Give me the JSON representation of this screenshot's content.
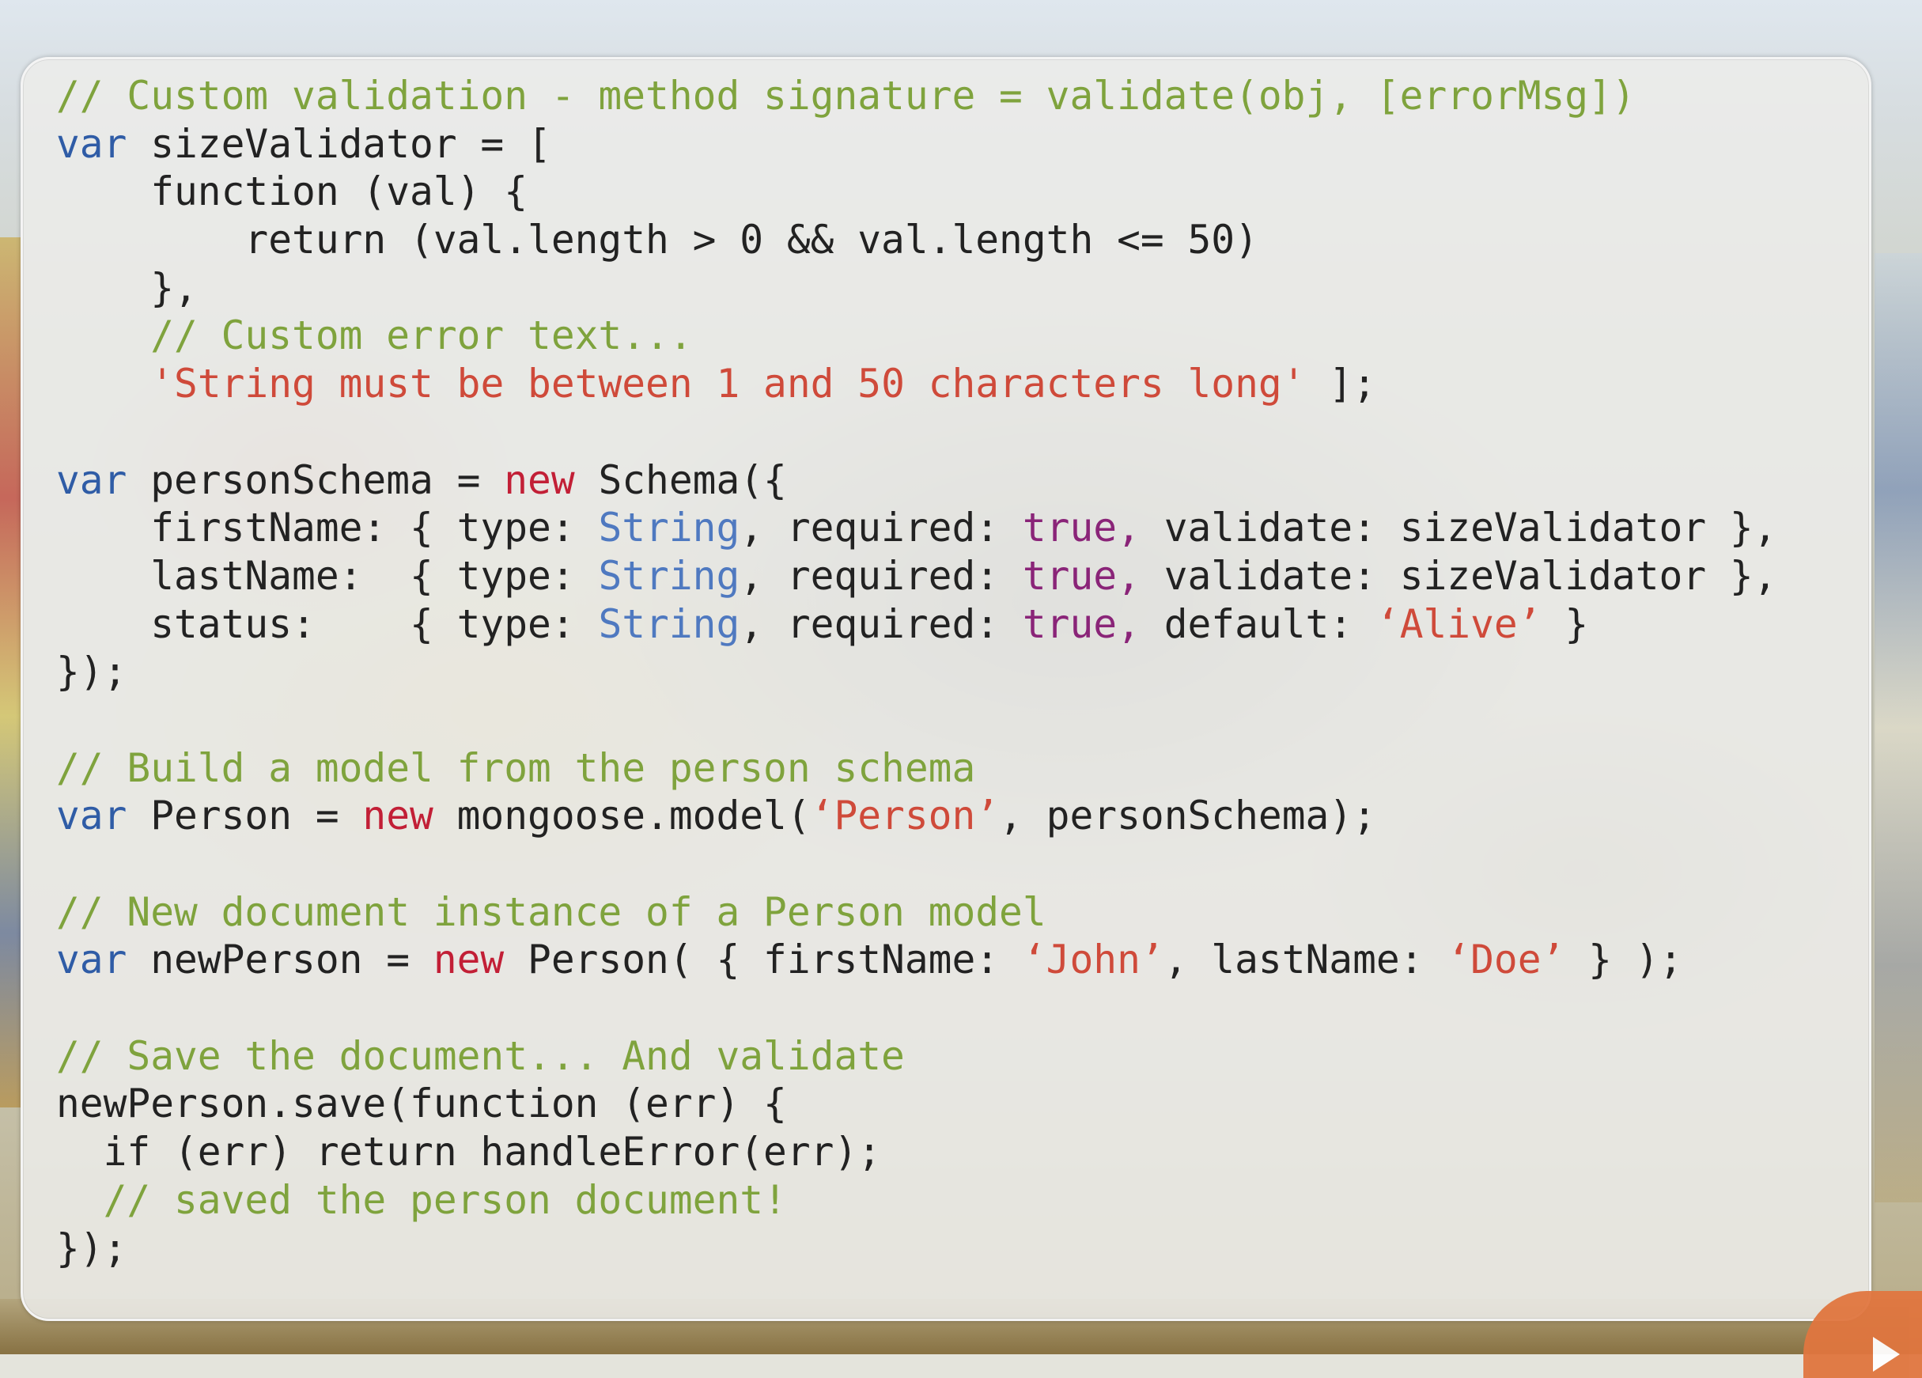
{
  "slide": {
    "background": "vintage-car-photo",
    "accent_color": "#e0763f"
  },
  "code_panel": {
    "colors": {
      "comment": "#7fa33d",
      "keyword": "#2f5ca6",
      "string": "#cf4a3a",
      "new": "#c21f36",
      "boolean": "#8a2478",
      "type": "#4f79c0",
      "plain": "#222222"
    },
    "lines": [
      [
        {
          "t": "// Custom validation - method signature = validate(obj, [errorMsg])",
          "c": "comment"
        }
      ],
      [
        {
          "t": "var",
          "c": "keyword"
        },
        {
          "t": " sizeValidator = [",
          "c": "plain"
        }
      ],
      [
        {
          "t": "    function (val) {",
          "c": "plain"
        }
      ],
      [
        {
          "t": "        return (val.length > 0 && val.length <= 50)",
          "c": "plain"
        }
      ],
      [
        {
          "t": "    },",
          "c": "plain"
        }
      ],
      [
        {
          "t": "    // Custom error text...",
          "c": "comment"
        }
      ],
      [
        {
          "t": "    ",
          "c": "plain"
        },
        {
          "t": "'String must be between 1 and 50 characters long'",
          "c": "string"
        },
        {
          "t": " ];",
          "c": "plain"
        }
      ],
      [],
      [
        {
          "t": "var",
          "c": "keyword"
        },
        {
          "t": " personSchema = ",
          "c": "plain"
        },
        {
          "t": "new",
          "c": "new"
        },
        {
          "t": " Schema({",
          "c": "plain"
        }
      ],
      [
        {
          "t": "    firstName: { type: ",
          "c": "plain"
        },
        {
          "t": "String",
          "c": "type"
        },
        {
          "t": ", required: ",
          "c": "plain"
        },
        {
          "t": "true,",
          "c": "bool"
        },
        {
          "t": " validate: sizeValidator },",
          "c": "plain"
        }
      ],
      [
        {
          "t": "    lastName:  { type: ",
          "c": "plain"
        },
        {
          "t": "String",
          "c": "type"
        },
        {
          "t": ", required: ",
          "c": "plain"
        },
        {
          "t": "true,",
          "c": "bool"
        },
        {
          "t": " validate: sizeValidator },",
          "c": "plain"
        }
      ],
      [
        {
          "t": "    status:    { type: ",
          "c": "plain"
        },
        {
          "t": "String",
          "c": "type"
        },
        {
          "t": ", required: ",
          "c": "plain"
        },
        {
          "t": "true,",
          "c": "bool"
        },
        {
          "t": " default: ",
          "c": "plain"
        },
        {
          "t": "‘Alive’",
          "c": "string"
        },
        {
          "t": " }",
          "c": "plain"
        }
      ],
      [
        {
          "t": "});",
          "c": "plain"
        }
      ],
      [],
      [
        {
          "t": "// Build a model from the person schema",
          "c": "comment"
        }
      ],
      [
        {
          "t": "var",
          "c": "keyword"
        },
        {
          "t": " Person = ",
          "c": "plain"
        },
        {
          "t": "new",
          "c": "new"
        },
        {
          "t": " mongoose.model(",
          "c": "plain"
        },
        {
          "t": "‘Person’",
          "c": "string"
        },
        {
          "t": ", personSchema);",
          "c": "plain"
        }
      ],
      [],
      [
        {
          "t": "// New document instance of a Person model",
          "c": "comment"
        }
      ],
      [
        {
          "t": "var",
          "c": "keyword"
        },
        {
          "t": " newPerson = ",
          "c": "plain"
        },
        {
          "t": "new",
          "c": "new"
        },
        {
          "t": " Person( { firstName: ",
          "c": "plain"
        },
        {
          "t": "‘John’",
          "c": "string"
        },
        {
          "t": ", lastName: ",
          "c": "plain"
        },
        {
          "t": "‘Doe’",
          "c": "string"
        },
        {
          "t": " } );",
          "c": "plain"
        }
      ],
      [],
      [
        {
          "t": "// Save the document... And validate",
          "c": "comment"
        }
      ],
      [
        {
          "t": "newPerson.save(function (err) {",
          "c": "plain"
        }
      ],
      [
        {
          "t": "  if (err) return handleError(err);",
          "c": "plain"
        }
      ],
      [
        {
          "t": "  // saved the person document!",
          "c": "comment"
        }
      ],
      [
        {
          "t": "});",
          "c": "plain"
        }
      ]
    ]
  },
  "controls": {
    "play_icon": "play-icon"
  }
}
